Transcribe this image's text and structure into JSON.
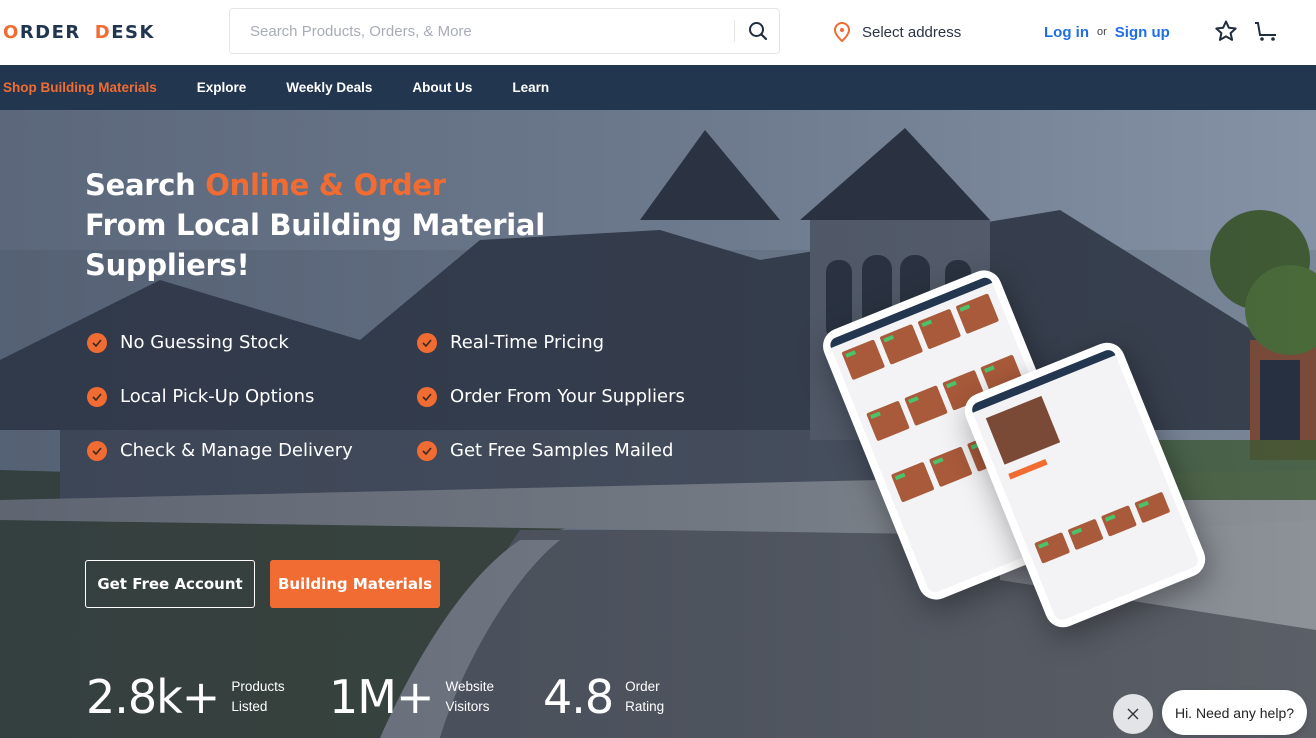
{
  "header": {
    "logo": {
      "part1_first": "O",
      "part1_rest": "RDER",
      "part2_first": "D",
      "part2_rest": "ESK"
    },
    "search": {
      "placeholder": "Search Products, Orders, & More",
      "value": "",
      "icon": "search-icon"
    },
    "address": {
      "label": "Select address",
      "icon": "map-pin-icon"
    },
    "auth": {
      "login": "Log in",
      "or": "or",
      "signup": "Sign up"
    },
    "icons": [
      "star-icon",
      "cart-icon"
    ]
  },
  "nav": {
    "items": [
      {
        "label": "Shop Building Materials",
        "active": true
      },
      {
        "label": "Explore"
      },
      {
        "label": "Weekly Deals"
      },
      {
        "label": "About Us"
      },
      {
        "label": "Learn"
      }
    ]
  },
  "hero": {
    "headline": {
      "line1_plain": "Search ",
      "line1_accent": "Online & Order",
      "line2": "From Local Building Material",
      "line3": "Suppliers!"
    },
    "features": [
      "No Guessing Stock",
      "Real-Time Pricing",
      "Local Pick-Up Options",
      "Order From Your Suppliers",
      "Check & Manage Delivery",
      "Get Free Samples Mailed"
    ],
    "buttons": {
      "primary_outline": "Get Free Account",
      "primary_fill": "Building Materials"
    },
    "stats": [
      {
        "value": "2.8k+",
        "label_line1": "Products",
        "label_line2": "Listed"
      },
      {
        "value": "1M+",
        "label_line1": "Website",
        "label_line2": "Visitors"
      },
      {
        "value": "4.8",
        "label_line1": "Order",
        "label_line2": "Rating"
      }
    ]
  },
  "chat": {
    "message": "Hi. Need any help?",
    "close_icon": "close-icon"
  },
  "colors": {
    "accent": "#f06c32",
    "navy": "#22364f",
    "link": "#1e6fe6"
  }
}
